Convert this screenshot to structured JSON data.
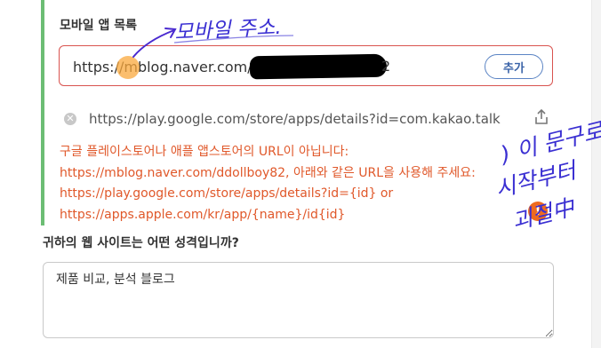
{
  "section": {
    "title": "모바일 앱 목록"
  },
  "url_input": {
    "value_before_redaction": "https://mblog.naver.com/",
    "value_visible_suffix": "2"
  },
  "add_button": {
    "label": "추가"
  },
  "app_list": [
    {
      "url": "https://play.google.com/store/apps/details?id=com.kakao.talk"
    }
  ],
  "error": {
    "lines": [
      "구글 플레이스토어나 애플 앱스토어의 URL이 아닙니다:",
      "https://mblog.naver.com/ddollboy82, 아래와 같은 URL을 사용해 주세요:",
      "https://play.google.com/store/apps/details?id={id} or",
      "https://apps.apple.com/kr/app/{name}/id{id}"
    ]
  },
  "question": {
    "label": "귀하의 웹 사이트는 어떤 성격입니까?",
    "answer": "제품 비교, 분석 블로그"
  },
  "annotations": {
    "top_note": "모바일 주소.",
    "side_note_1": ") 이 문구로",
    "side_note_2": "시작부터",
    "side_note_3": "괴절中",
    "ink_color": "#3a2fd2"
  },
  "colors": {
    "accent_green": "#6cbd74",
    "error_orange": "#e0582a",
    "error_border": "#d9534f",
    "button_blue": "#3a63a8",
    "warning_orange": "#ee6a1f"
  }
}
